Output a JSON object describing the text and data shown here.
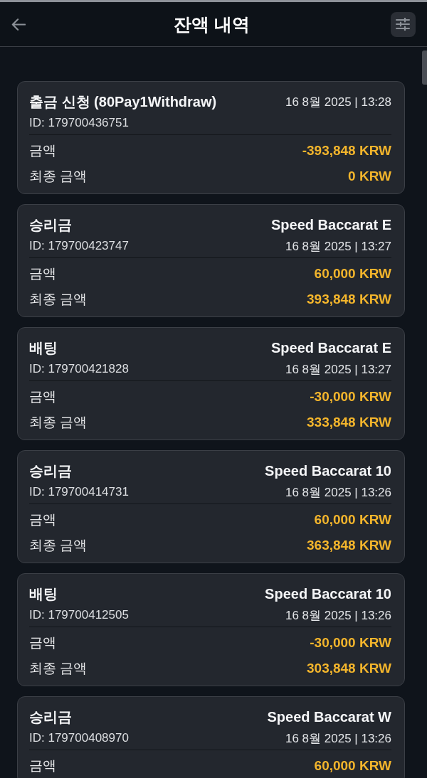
{
  "header": {
    "title": "잔액 내역"
  },
  "transactions": [
    {
      "title": "출금 신청 (80Pay1Withdraw)",
      "id": "ID: 179700436751",
      "date": "16 8월 2025 | 13:28",
      "amount_label": "금액",
      "amount": "-393,848 KRW",
      "final_label": "최종 금액",
      "final_amount": "0 KRW"
    },
    {
      "title": "승리금",
      "game": "Speed Baccarat E",
      "id": "ID: 179700423747",
      "date": "16 8월 2025 | 13:27",
      "amount_label": "금액",
      "amount": "60,000 KRW",
      "final_label": "최종 금액",
      "final_amount": "393,848 KRW"
    },
    {
      "title": "배팅",
      "game": "Speed Baccarat E",
      "id": "ID: 179700421828",
      "date": "16 8월 2025 | 13:27",
      "amount_label": "금액",
      "amount": "-30,000 KRW",
      "final_label": "최종 금액",
      "final_amount": "333,848 KRW"
    },
    {
      "title": "승리금",
      "game": "Speed Baccarat 10",
      "id": "ID: 179700414731",
      "date": "16 8월 2025 | 13:26",
      "amount_label": "금액",
      "amount": "60,000 KRW",
      "final_label": "최종 금액",
      "final_amount": "363,848 KRW"
    },
    {
      "title": "배팅",
      "game": "Speed Baccarat 10",
      "id": "ID: 179700412505",
      "date": "16 8월 2025 | 13:26",
      "amount_label": "금액",
      "amount": "-30,000 KRW",
      "final_label": "최종 금액",
      "final_amount": "303,848 KRW"
    },
    {
      "title": "승리금",
      "game": "Speed Baccarat W",
      "id": "ID: 179700408970",
      "date": "16 8월 2025 | 13:26",
      "amount_label": "금액",
      "amount": "60,000 KRW"
    }
  ]
}
